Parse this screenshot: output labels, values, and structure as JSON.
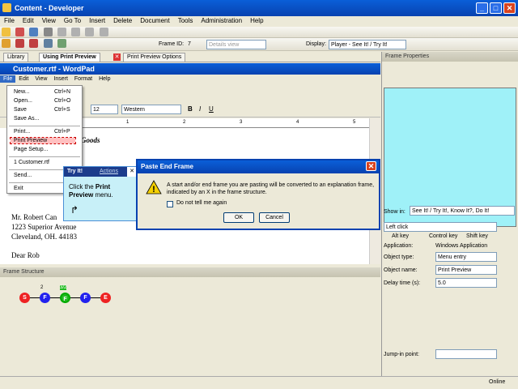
{
  "window": {
    "title": "Content - Developer"
  },
  "menu": [
    "File",
    "Edit",
    "View",
    "Go To",
    "Insert",
    "Delete",
    "Document",
    "Tools",
    "Administration",
    "Help"
  ],
  "toolbar2": {
    "view_select": "Details view",
    "frame_id_label": "Frame ID:",
    "frame_id": "7",
    "display_label": "Display:",
    "display_value": "Player - See It! / Try It!"
  },
  "tabs": [
    "Library",
    "Using Print Preview",
    "Print Preview Options"
  ],
  "wordpad": {
    "title": "Customer.rtf - WordPad",
    "menu": [
      "File",
      "Edit",
      "View",
      "Insert",
      "Format",
      "Help"
    ],
    "font_size": "12",
    "script": "Western",
    "doc_heading": "Goods",
    "address": [
      "Mr. Robert Can",
      "1223 Superior Avenue",
      "Cleveland, OH. 44183"
    ],
    "partial_line": "Dear Rob"
  },
  "file_menu": [
    {
      "label": "New...",
      "shortcut": "Ctrl+N"
    },
    {
      "label": "Open...",
      "shortcut": "Ctrl+O"
    },
    {
      "label": "Save",
      "shortcut": "Ctrl+S"
    },
    {
      "label": "Save As...",
      "shortcut": ""
    },
    {
      "label": "Print...",
      "shortcut": "Ctrl+P"
    },
    {
      "label": "Print Preview",
      "shortcut": ""
    },
    {
      "label": "Page Setup...",
      "shortcut": ""
    },
    {
      "label": "1 Customer.rtf",
      "shortcut": ""
    },
    {
      "label": "Send...",
      "shortcut": ""
    },
    {
      "label": "Exit",
      "shortcut": ""
    }
  ],
  "callout": {
    "tab1": "Try It!",
    "tab2": "Actions",
    "text1": "Click the ",
    "bold": "Print Preview",
    "text2": " menu."
  },
  "dialog": {
    "title": "Paste End Frame",
    "message": "A start and/or end frame you are pasting will be converted to an explanation frame, indicated by an X in the frame structure.",
    "checkbox": "Do not tell me again",
    "ok": "OK",
    "cancel": "Cancel"
  },
  "frame_structure": {
    "title": "Frame Structure",
    "nodes": [
      "S",
      "F",
      "F",
      "F",
      "E"
    ],
    "labels": [
      "2",
      "3/2"
    ]
  },
  "frame_properties": {
    "title": "Frame Properties",
    "show_in_label": "Show in:",
    "show_in_value": "See It! / Try It!, Know It?, Do It!",
    "action_value": "Left click",
    "checks": [
      "Alt key",
      "Control key",
      "Shift key"
    ],
    "application_label": "Application:",
    "application_value": "Windows Application",
    "object_type_label": "Object type:",
    "object_type_value": "Menu entry",
    "object_name_label": "Object name:",
    "object_name_value": "Print Preview",
    "delay_label": "Delay time (s):",
    "delay_value": "5.0",
    "jump_label": "Jump-in point:"
  },
  "status": {
    "online": "Online"
  },
  "ruler_marks": [
    "1",
    "2",
    "3",
    "4",
    "5"
  ]
}
